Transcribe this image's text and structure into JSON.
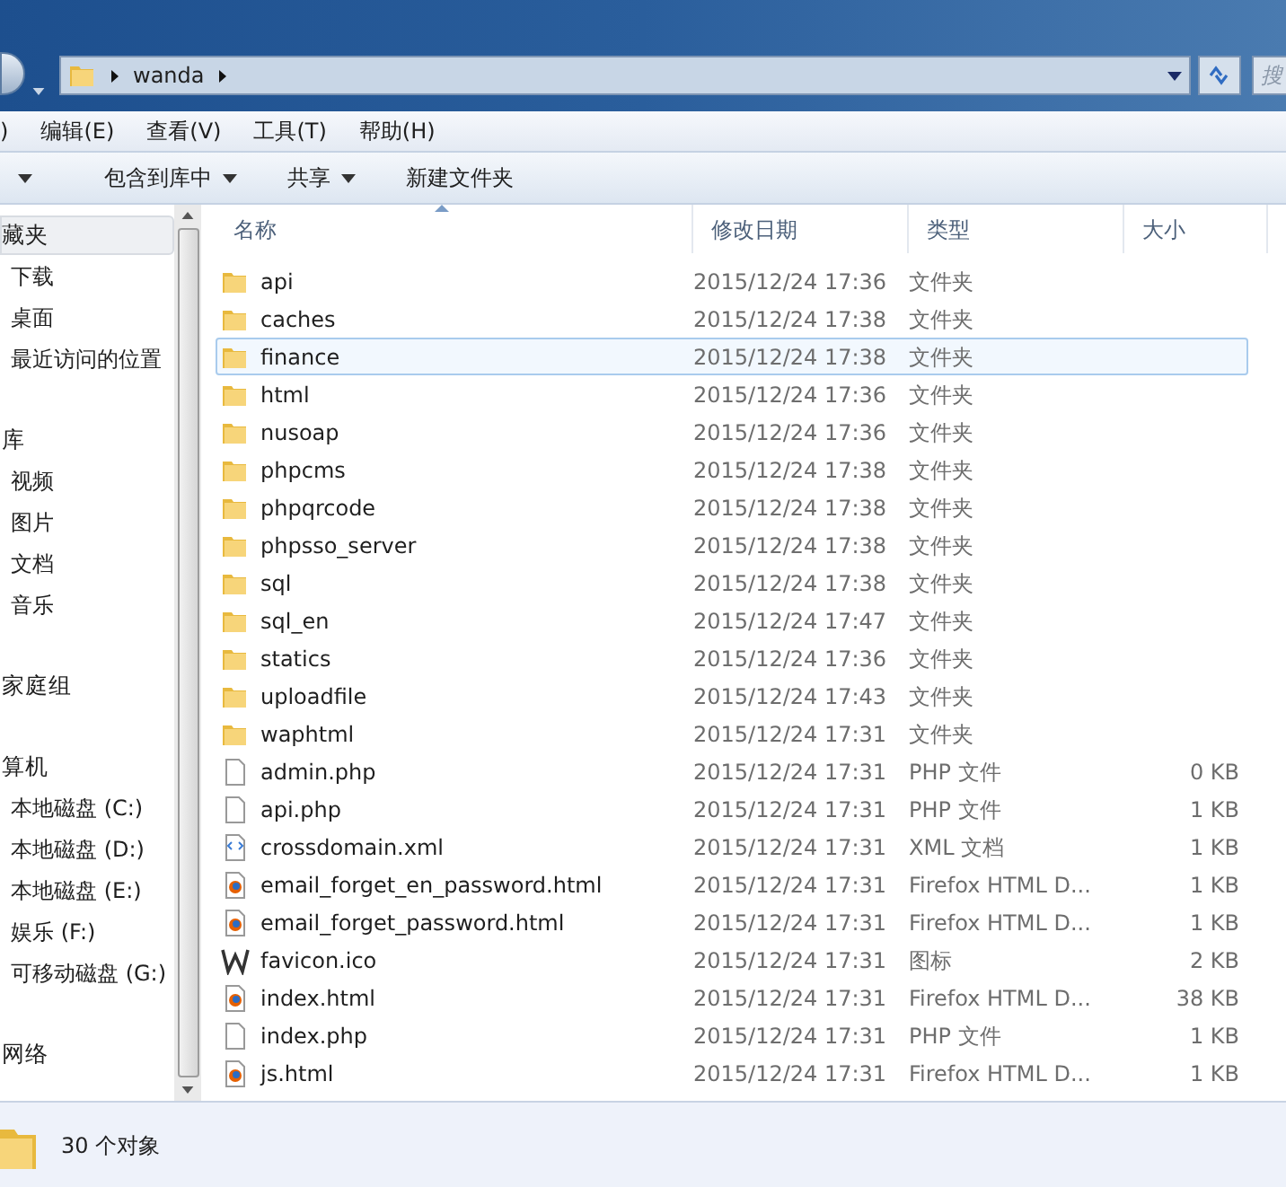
{
  "address_bar": {
    "path": [
      "wanda"
    ],
    "search_placeholder": "搜"
  },
  "menu_bar": [
    ")",
    "编辑(E)",
    "查看(V)",
    "工具(T)",
    "帮助(H)"
  ],
  "toolbar": [
    {
      "dropdown": true
    },
    {
      "label": "包含到库中",
      "dropdown": true
    },
    {
      "label": "共享",
      "dropdown": true
    },
    {
      "label": "新建文件夹",
      "dropdown": false
    }
  ],
  "sidebar": {
    "groups": [
      {
        "label": "藏夹",
        "selected": true,
        "children": [
          {
            "label": "下载"
          },
          {
            "label": "桌面"
          },
          {
            "label": "最近访问的位置"
          }
        ]
      },
      {
        "label": "库",
        "selected": false,
        "children": [
          {
            "label": "视频"
          },
          {
            "label": "图片"
          },
          {
            "label": "文档"
          },
          {
            "label": "音乐"
          }
        ]
      },
      {
        "label": "家庭组",
        "selected": false
      },
      {
        "label": "算机",
        "selected": false,
        "children": [
          {
            "label": "本地磁盘 (C:)"
          },
          {
            "label": "本地磁盘 (D:)"
          },
          {
            "label": "本地磁盘 (E:)"
          },
          {
            "label": "娱乐 (F:)"
          },
          {
            "label": "可移动磁盘 (G:)"
          }
        ]
      },
      {
        "label": "网络",
        "selected": false
      }
    ]
  },
  "table": {
    "columns": [
      "名称",
      "修改日期",
      "类型",
      "大小"
    ],
    "rows": [
      {
        "kind": "folder",
        "name": "api",
        "date": "2015/12/24 17:36",
        "type": "文件夹",
        "selected": false
      },
      {
        "kind": "folder",
        "name": "caches",
        "date": "2015/12/24 17:38",
        "type": "文件夹",
        "selected": false
      },
      {
        "kind": "folder",
        "name": "finance",
        "date": "2015/12/24 17:38",
        "type": "文件夹",
        "selected": true
      },
      {
        "kind": "folder",
        "name": "html",
        "date": "2015/12/24 17:36",
        "type": "文件夹",
        "selected": false
      },
      {
        "kind": "folder",
        "name": "nusoap",
        "date": "2015/12/24 17:36",
        "type": "文件夹",
        "selected": false
      },
      {
        "kind": "folder",
        "name": "phpcms",
        "date": "2015/12/24 17:38",
        "type": "文件夹",
        "selected": false
      },
      {
        "kind": "folder",
        "name": "phpqrcode",
        "date": "2015/12/24 17:38",
        "type": "文件夹",
        "selected": false
      },
      {
        "kind": "folder",
        "name": "phpsso_server",
        "date": "2015/12/24 17:38",
        "type": "文件夹",
        "selected": false
      },
      {
        "kind": "folder",
        "name": "sql",
        "date": "2015/12/24 17:38",
        "type": "文件夹",
        "selected": false
      },
      {
        "kind": "folder",
        "name": "sql_en",
        "date": "2015/12/24 17:47",
        "type": "文件夹",
        "selected": false
      },
      {
        "kind": "folder",
        "name": "statics",
        "date": "2015/12/24 17:36",
        "type": "文件夹",
        "selected": false
      },
      {
        "kind": "folder",
        "name": "uploadfile",
        "date": "2015/12/24 17:43",
        "type": "文件夹",
        "selected": false
      },
      {
        "kind": "folder",
        "name": "waphtml",
        "date": "2015/12/24 17:31",
        "type": "文件夹",
        "selected": false
      },
      {
        "kind": "blank",
        "name": "admin.php",
        "date": "2015/12/24 17:31",
        "type": "PHP 文件",
        "size": "0 KB",
        "selected": false
      },
      {
        "kind": "blank",
        "name": "api.php",
        "date": "2015/12/24 17:31",
        "type": "PHP 文件",
        "size": "1 KB",
        "selected": false
      },
      {
        "kind": "xml",
        "name": "crossdomain.xml",
        "date": "2015/12/24 17:31",
        "type": "XML 文档",
        "size": "1 KB",
        "selected": false
      },
      {
        "kind": "html",
        "name": "email_forget_en_password.html",
        "date": "2015/12/24 17:31",
        "type": "Firefox HTML D...",
        "size": "1 KB",
        "selected": false
      },
      {
        "kind": "html",
        "name": "email_forget_password.html",
        "date": "2015/12/24 17:31",
        "type": "Firefox HTML D...",
        "size": "1 KB",
        "selected": false
      },
      {
        "kind": "ico",
        "name": "favicon.ico",
        "date": "2015/12/24 17:31",
        "type": "图标",
        "size": "2 KB",
        "selected": false
      },
      {
        "kind": "html",
        "name": "index.html",
        "date": "2015/12/24 17:31",
        "type": "Firefox HTML D...",
        "size": "38 KB",
        "selected": false
      },
      {
        "kind": "blank",
        "name": "index.php",
        "date": "2015/12/24 17:31",
        "type": "PHP 文件",
        "size": "1 KB",
        "selected": false
      },
      {
        "kind": "html",
        "name": "js.html",
        "date": "2015/12/24 17:31",
        "type": "Firefox HTML D...",
        "size": "1 KB",
        "selected": false
      }
    ]
  },
  "status_bar": {
    "count": "30 个对象"
  }
}
